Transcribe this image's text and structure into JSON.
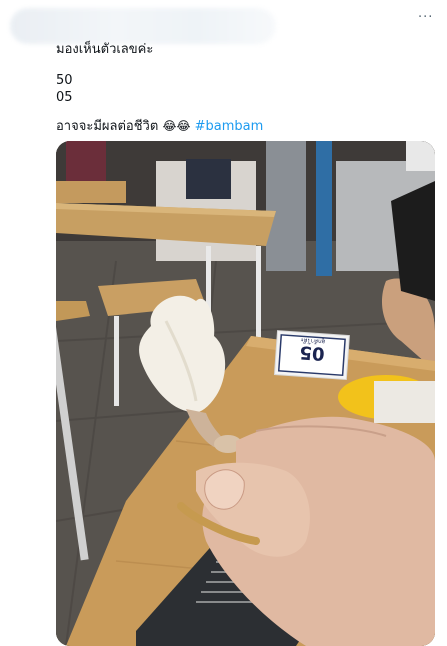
{
  "header": {
    "menu_icon": "more-horizontal-icon",
    "menu_glyph": "···"
  },
  "tweet": {
    "line1": "มองเห็นตัวเลขค่ะ",
    "line2": "50",
    "line3": "05",
    "line4_text": "อาจจะมีผลต่อชีวิต",
    "line4_emoji": "😂😂",
    "hashtag": "#bambam"
  },
  "photo": {
    "sign_number": "05",
    "sign_caption": "ลูกค้าโต๊ะ",
    "accent": "#1d9bf0"
  }
}
